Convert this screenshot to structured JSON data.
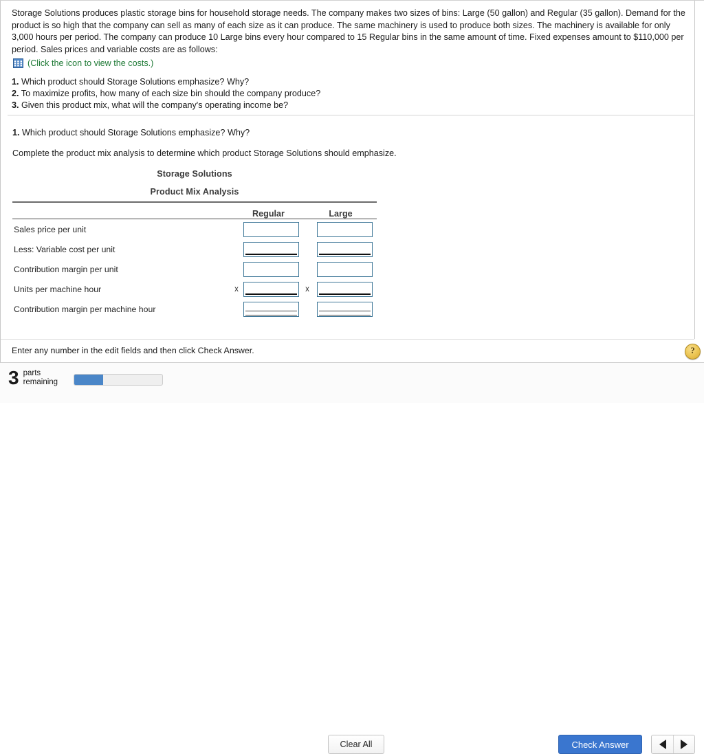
{
  "problem": {
    "paragraph": "Storage Solutions produces plastic storage bins for household storage needs. The company makes two sizes of bins: Large (50 gallon) and Regular (35 gallon). Demand for the product is so high that the company can sell as many of each size as it can produce. The same machinery is used to produce both sizes. The machinery is available for only 3,000 hours per period. The company can produce 10 Large bins every hour compared to 15 Regular bins in the same amount of time. Fixed expenses amount to $110,000 per period. Sales prices and variable costs are as follows:",
    "icon_name": "table-grid-icon",
    "icon_link_text": "(Click the icon to view the costs.)",
    "icon_color": "#1f7a36",
    "questions": [
      {
        "number": "1.",
        "text": "Which product should Storage Solutions emphasize? Why?"
      },
      {
        "number": "2.",
        "text": "To maximize profits, how many of each size bin should the company produce?"
      },
      {
        "number": "3.",
        "text": "Given this product mix, what will the company's operating income be?"
      }
    ]
  },
  "restated": {
    "number": "1.",
    "text": "Which product should Storage Solutions emphasize? Why?",
    "instruction": "Complete the product mix analysis to determine which product Storage Solutions should emphasize."
  },
  "worksheet": {
    "title_line1": "Storage Solutions",
    "title_line2": "Product Mix Analysis",
    "columns": [
      "Regular",
      "Large"
    ],
    "multiplier_symbol": "x",
    "rows": [
      {
        "label": "Sales price per unit",
        "regular": "",
        "large": "",
        "rule": "none",
        "multiplier": false
      },
      {
        "label": "Less: Variable cost per unit",
        "regular": "",
        "large": "",
        "rule": "single",
        "multiplier": false
      },
      {
        "label": "Contribution margin per unit",
        "regular": "",
        "large": "",
        "rule": "none",
        "multiplier": false
      },
      {
        "label": "Units per machine hour",
        "regular": "",
        "large": "",
        "rule": "single",
        "multiplier": true
      },
      {
        "label": "Contribution margin per machine hour",
        "regular": "",
        "large": "",
        "rule": "double",
        "multiplier": false
      }
    ]
  },
  "hint": {
    "text": "Enter any number in the edit fields and then click Check Answer.",
    "help_label": "?",
    "help_icon_name": "help-question-icon"
  },
  "footer": {
    "parts_count": "3",
    "parts_word_line1": "parts",
    "parts_word_line2": "remaining",
    "progress_percent": 33,
    "clear_label": "Clear All",
    "check_label": "Check Answer",
    "prev_icon": "previous-arrow-icon",
    "next_icon": "next-arrow-icon",
    "accent_blue": "#3a76cf",
    "progress_blue": "#4a86c8"
  }
}
